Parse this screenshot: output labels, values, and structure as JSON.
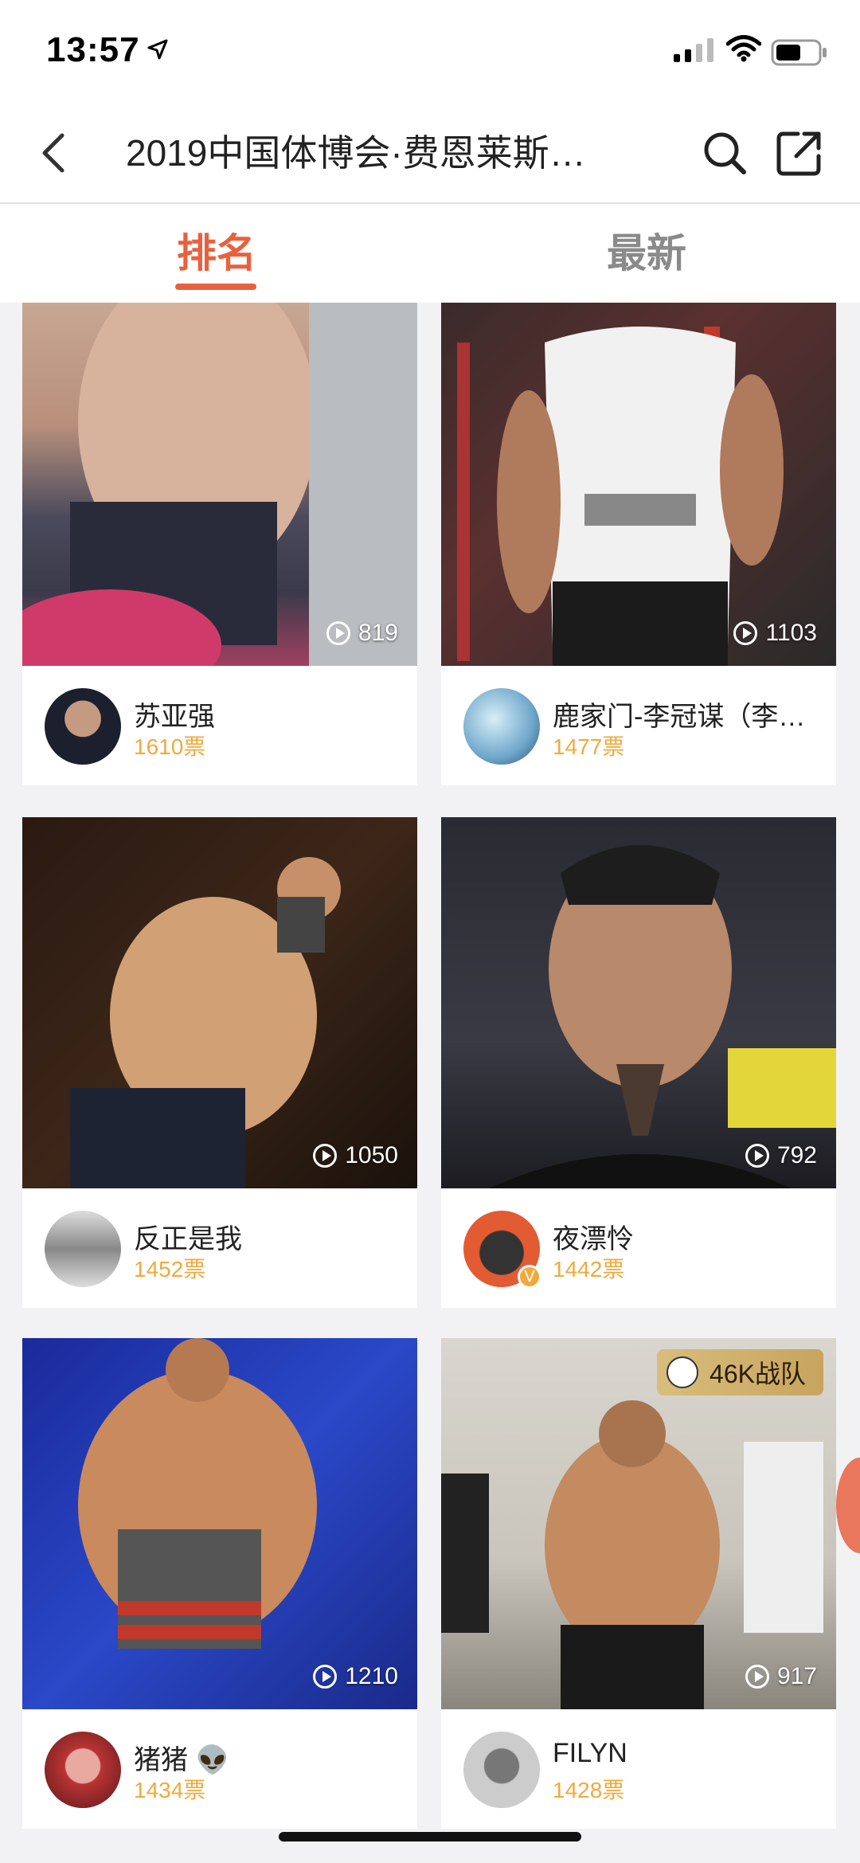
{
  "status_bar": {
    "time": "13:57"
  },
  "nav": {
    "title": "2019中国体博会·费恩莱斯…"
  },
  "tabs": [
    {
      "label": "排名"
    },
    {
      "label": "最新"
    }
  ],
  "cards": [
    {
      "name": "苏亚强",
      "votes": "1610票",
      "views": "819"
    },
    {
      "name": "鹿家门-李冠谋（李…",
      "votes": "1477票",
      "views": "1103"
    },
    {
      "name": "反正是我",
      "votes": "1452票",
      "views": "1050"
    },
    {
      "name": "夜漂怜",
      "votes": "1442票",
      "views": "792"
    },
    {
      "name": "猪猪 👽",
      "votes": "1434票",
      "views": "1210"
    },
    {
      "name": "FILYN",
      "votes": "1428票",
      "views": "917",
      "badge": "46K战队"
    }
  ],
  "colors": {
    "accent": "#e8613f",
    "votes": "#efaa3c"
  }
}
